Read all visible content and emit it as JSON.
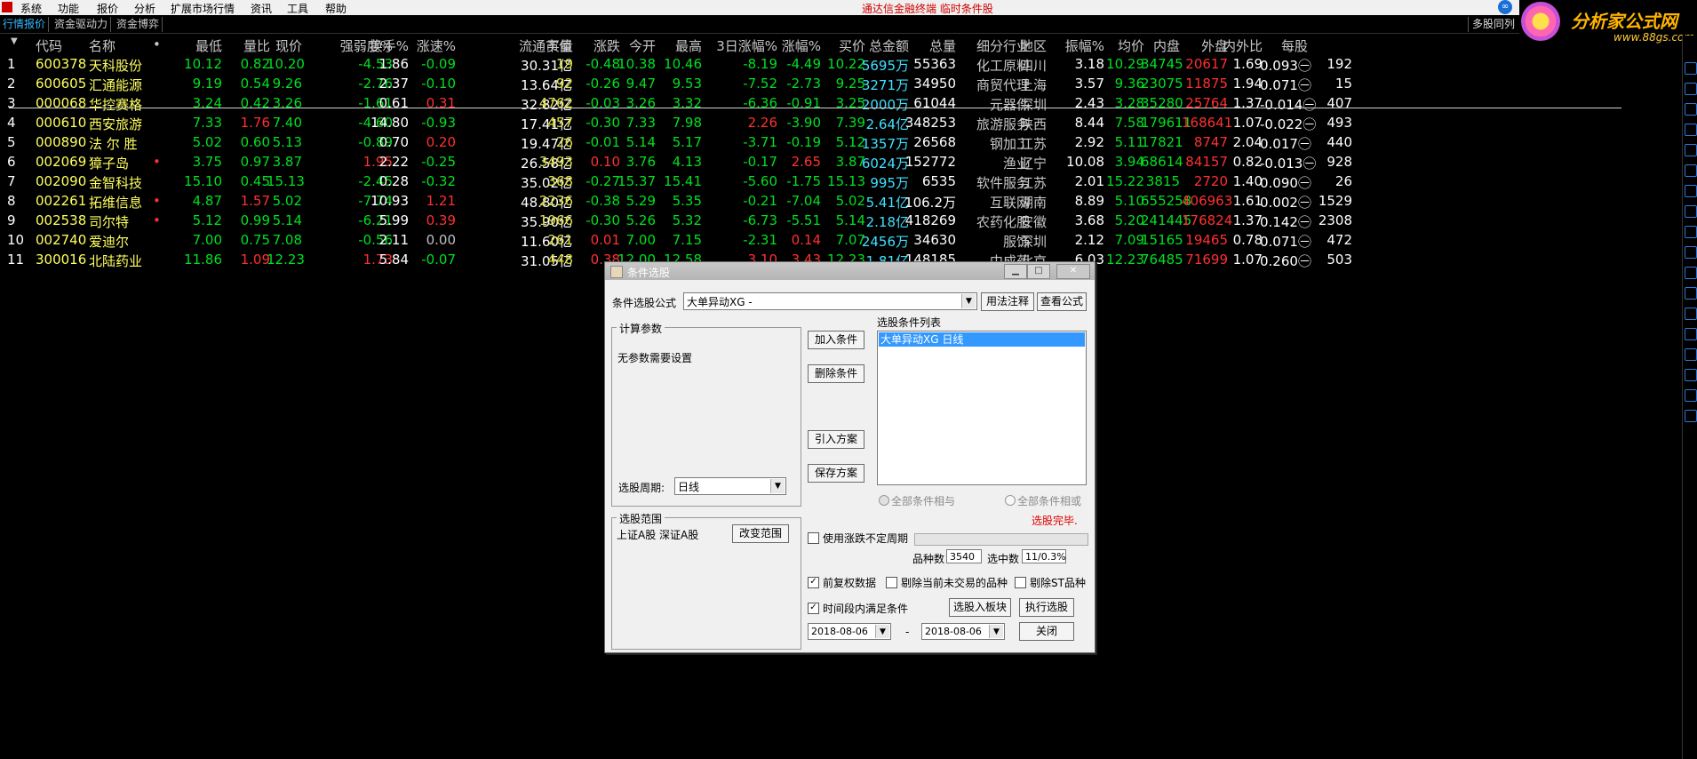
{
  "menubar": {
    "items": [
      "系统",
      "功能",
      "报价",
      "分析",
      "扩展市场行情",
      "资讯",
      "工具",
      "帮助"
    ],
    "title": "通达信金融终端 临时条件股"
  },
  "tabs": {
    "items": [
      "行情报价",
      "资金驱动力",
      "资金博弈"
    ],
    "right": "多股同列"
  },
  "brand": {
    "name": "分析家公式网",
    "url": "www.88gs.com"
  },
  "table": {
    "headers": [
      "代码",
      "名称",
      "•",
      "最低",
      "量比",
      "现价",
      "强弱度%",
      "换手%",
      "涨速%",
      "流通市值",
      "买量",
      "涨跌",
      "今开",
      "最高",
      "3日涨幅%",
      "涨幅%",
      "买价",
      "总金额",
      "总量",
      "细分行业",
      "地区",
      "振幅%",
      "均价",
      "内盘",
      "外盘",
      "内外比",
      "每股",
      "",
      ""
    ],
    "rows": [
      [
        "1",
        "600378",
        "天科股份",
        "",
        "10.12",
        "0.82",
        "10.20",
        "-4.53",
        "1.86",
        "-0.09",
        "30.31亿",
        "19",
        "-0.48",
        "10.38",
        "10.46",
        "-8.19",
        "-4.49",
        "10.22",
        "5695万",
        "55363",
        "化工原料",
        "四川",
        "3.18",
        "10.29",
        "34745",
        "20617",
        "1.69",
        "0.093㊀",
        "192"
      ],
      [
        "2",
        "600605",
        "汇通能源",
        "",
        "9.19",
        "0.54",
        "9.26",
        "-2.76",
        "2.37",
        "-0.10",
        "13.64亿",
        "92",
        "-0.26",
        "9.47",
        "9.53",
        "-7.52",
        "-2.73",
        "9.25",
        "3271万",
        "34950",
        "商贸代理",
        "上海",
        "3.57",
        "9.36",
        "23075",
        "11875",
        "1.94",
        "0.071㊀",
        "15"
      ],
      [
        "3",
        "000068",
        "华控赛格",
        "",
        "3.24",
        "0.42",
        "3.26",
        "-1.61",
        "0.61",
        "0.31",
        "32.82亿",
        "4762",
        "-0.03",
        "3.26",
        "3.32",
        "-6.36",
        "-0.91",
        "3.25",
        "2000万",
        "61044",
        "元器件",
        "深圳",
        "2.43",
        "3.28",
        "35280",
        "25764",
        "1.37",
        "-0.014㊀",
        "407"
      ],
      [
        "4",
        "000610",
        "西安旅游",
        "",
        "7.33",
        "1.76",
        "7.40",
        "-4.60",
        "14.80",
        "-0.93",
        "17.41亿",
        "457",
        "-0.30",
        "7.33",
        "7.98",
        "2.26",
        "-3.90",
        "7.39",
        "2.64亿",
        "348253",
        "旅游服务",
        "陕西",
        "8.44",
        "7.58",
        "179611",
        "168641",
        "1.07",
        "-0.022㊀",
        "493"
      ],
      [
        "5",
        "000890",
        "法 尔 胜",
        "",
        "5.02",
        "0.60",
        "5.13",
        "-0.89",
        "0.70",
        "0.20",
        "19.47亿",
        "26",
        "-0.01",
        "5.14",
        "5.17",
        "-3.71",
        "-0.19",
        "5.12",
        "1357万",
        "26568",
        "钢加工",
        "江苏",
        "2.92",
        "5.11",
        "17821",
        "8747",
        "2.04",
        "0.017㊀",
        "440"
      ],
      [
        "6",
        "002069",
        "獐子岛",
        "•",
        "3.75",
        "0.97",
        "3.87",
        "1.95",
        "2.22",
        "-0.25",
        "26.58亿",
        "3493",
        "0.10",
        "3.76",
        "4.13",
        "-0.17",
        "2.65",
        "3.87",
        "6024万",
        "152772",
        "渔业",
        "辽宁",
        "10.08",
        "3.94",
        "68614",
        "84157",
        "0.82",
        "-0.013㊀",
        "928"
      ],
      [
        "7",
        "002090",
        "金智科技",
        "",
        "15.10",
        "0.45",
        "15.13",
        "-2.45",
        "0.28",
        "-0.32",
        "35.02亿",
        "368",
        "-0.27",
        "15.37",
        "15.41",
        "-5.60",
        "-1.75",
        "15.13",
        "995万",
        "6535",
        "软件服务",
        "江苏",
        "2.01",
        "15.22",
        "3815",
        "2720",
        "1.40",
        "0.090㊀",
        "26"
      ],
      [
        "8",
        "002261",
        "拓维信息",
        "•",
        "4.87",
        "1.57",
        "5.02",
        "-7.74",
        "10.93",
        "1.21",
        "48.80亿",
        "2236",
        "-0.38",
        "5.29",
        "5.35",
        "-0.21",
        "-7.04",
        "5.02",
        "5.41亿",
        "106.2万",
        "互联网",
        "湖南",
        "8.89",
        "5.10",
        "655258",
        "406963",
        "1.61",
        "0.002㊀",
        "1529"
      ],
      [
        "9",
        "002538",
        "司尔特",
        "•",
        "5.12",
        "0.99",
        "5.14",
        "-6.21",
        "5.99",
        "0.39",
        "35.90亿",
        "1966",
        "-0.30",
        "5.26",
        "5.32",
        "-6.73",
        "-5.51",
        "5.14",
        "2.18亿",
        "418269",
        "农药化肥",
        "安徽",
        "3.68",
        "5.20",
        "241445",
        "176824",
        "1.37",
        "0.142㊀",
        "2308"
      ],
      [
        "10",
        "002740",
        "爱迪尔",
        "",
        "7.00",
        "0.75",
        "7.08",
        "-0.56",
        "2.11",
        "0.00",
        "11.60亿",
        "261",
        "0.01",
        "7.00",
        "7.15",
        "-2.31",
        "0.14",
        "7.07",
        "2456万",
        "34630",
        "服饰",
        "深圳",
        "2.12",
        "7.09",
        "15165",
        "19465",
        "0.78",
        "0.071㊀",
        "472"
      ],
      [
        "11",
        "300016",
        "北陆药业",
        "",
        "11.86",
        "1.09",
        "12.23",
        "1.73",
        "5.84",
        "-0.07",
        "31.05亿",
        "448",
        "0.38",
        "12.00",
        "12.58",
        "3.10",
        "3.43",
        "12.23",
        "1.81亿",
        "148185",
        "中成药",
        "北京",
        "6.03",
        "12.23",
        "76485",
        "71699",
        "1.07",
        "0.260㊀",
        "503"
      ]
    ]
  },
  "dialog": {
    "title": "条件选股",
    "formula_label": "条件选股公式",
    "formula_value": "大单异动XG   -",
    "btn_usage": "用法注释",
    "btn_view": "查看公式",
    "params_group": "计算参数",
    "no_params": "无参数需要设置",
    "period_label": "选股周期:",
    "period_value": "日线",
    "btn_add": "加入条件",
    "btn_delete": "删除条件",
    "btn_import": "引入方案",
    "btn_save": "保存方案",
    "list_label": "选股条件列表",
    "list_items": [
      "大单异动XG  日线"
    ],
    "radio_and": "全部条件相与",
    "radio_or": "全部条件相或",
    "status": "选股完毕.",
    "range_group": "选股范围",
    "range_value": "上证A股  深证A股",
    "btn_change_range": "改变范围",
    "chk_uncertain": "使用涨跌不定周期",
    "count_label": "品种数",
    "count_value": "3540",
    "selected_label": "选中数",
    "selected_value": "11/0.3%",
    "chk_restore": "前复权数据",
    "chk_exclude_untraded": "剔除当前未交易的品种",
    "chk_exclude_st": "剔除ST品种",
    "chk_timerange": "时间段内满足条件",
    "btn_to_block": "选股入板块",
    "btn_execute": "执行选股",
    "date_from": "2018-08-06",
    "date_sep": "-",
    "date_to": "2018-08-06",
    "btn_close": "关闭"
  },
  "colors": {
    "up": "#ff3030",
    "down": "#00e020",
    "code": "#ffff60",
    "amount": "#40e0ff"
  }
}
